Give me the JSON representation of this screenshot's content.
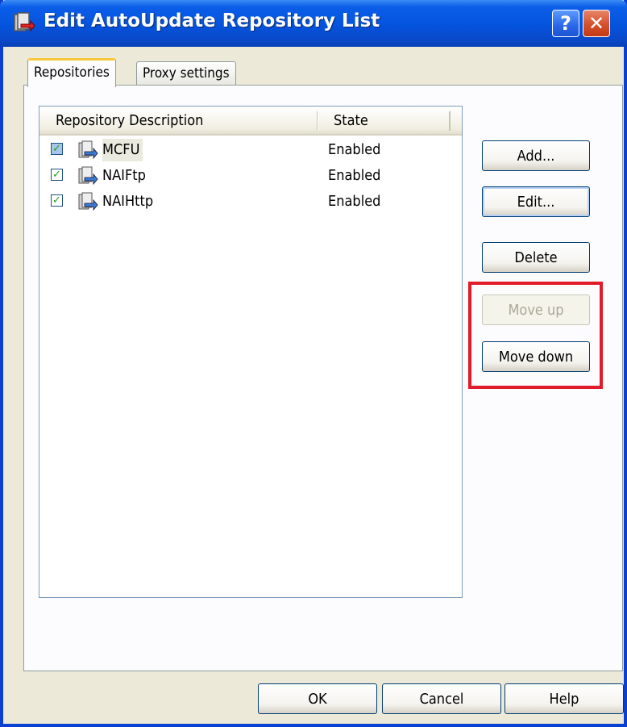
{
  "window": {
    "title": "Edit AutoUpdate Repository List",
    "help_glyph": "?",
    "close_glyph": "✕"
  },
  "tabs": [
    {
      "label": "Repositories",
      "active": true
    },
    {
      "label": "Proxy settings",
      "active": false
    }
  ],
  "list": {
    "columns": [
      "Repository Description",
      "State"
    ],
    "rows": [
      {
        "name": "MCFU",
        "state": "Enabled",
        "checked": true,
        "selected": true
      },
      {
        "name": "NAIFtp",
        "state": "Enabled",
        "checked": true,
        "selected": false
      },
      {
        "name": "NAIHttp",
        "state": "Enabled",
        "checked": true,
        "selected": false
      }
    ],
    "check_glyph": "✓"
  },
  "side_buttons": {
    "add": "Add...",
    "edit": "Edit...",
    "delete": "Delete",
    "move_up": "Move up",
    "move_down": "Move down"
  },
  "bottom_buttons": {
    "ok": "OK",
    "cancel": "Cancel",
    "help": "Help"
  },
  "colors": {
    "titlebar": "#0453dd",
    "dialog_bg": "#ece9d8",
    "highlight": "#e01c2a"
  }
}
